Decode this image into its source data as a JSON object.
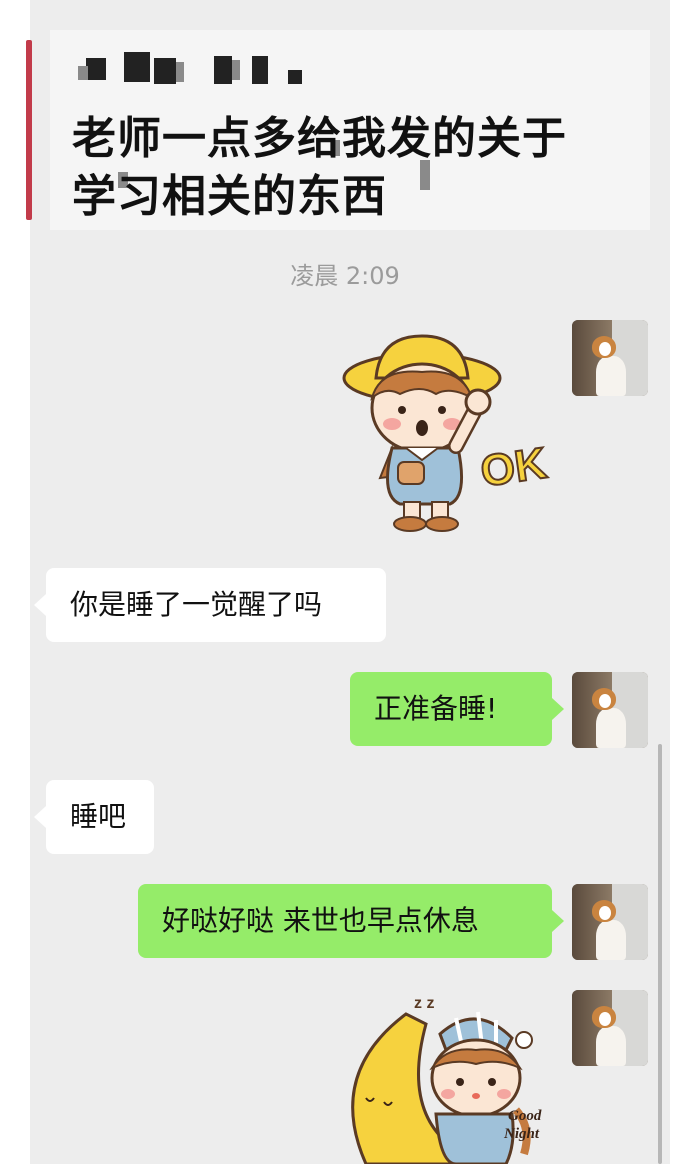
{
  "caption": {
    "title_line1": "老师一点多给我发的关于",
    "title_line2": "学习相关的东西"
  },
  "chat": {
    "timestamp": "凌晨 2:09",
    "messages": [
      {
        "side": "right",
        "type": "sticker",
        "sticker": "ok-girl-sticker",
        "text": "OK"
      },
      {
        "side": "left",
        "type": "text",
        "text": "你是睡了一觉醒了吗"
      },
      {
        "side": "right",
        "type": "text",
        "text": "正准备睡!"
      },
      {
        "side": "left",
        "type": "text",
        "text": "睡吧"
      },
      {
        "side": "right",
        "type": "text",
        "text": "好哒好哒 来世也早点休息"
      },
      {
        "side": "right",
        "type": "sticker",
        "sticker": "good-night-moon-sticker",
        "text": "Good Night"
      }
    ]
  },
  "colors": {
    "chat_background": "#ededed",
    "right_bubble": "#95ec69",
    "left_bubble": "#ffffff",
    "timestamp_text": "#9b9b9b"
  }
}
